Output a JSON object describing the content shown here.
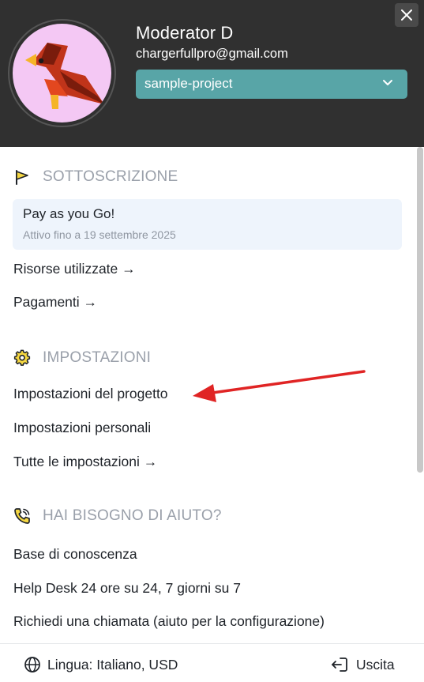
{
  "user": {
    "name": "Moderator D",
    "email": "chargerfullpro@gmail.com",
    "avatar_icon": "cardinal-bird-avatar"
  },
  "project_select": {
    "value": "sample-project"
  },
  "subscription": {
    "title": "SOTTOSCRIZIONE",
    "icon": "flag-icon",
    "plan_name": "Pay as you Go!",
    "plan_valid": "Attivo fino a 19 settembre 2025",
    "links": [
      "Risorse utilizzate →",
      "Pagamenti →"
    ]
  },
  "settings": {
    "title": "IMPOSTAZIONI",
    "icon": "gear-icon",
    "links": [
      "Impostazioni del progetto",
      "Impostazioni personali",
      "Tutte le impostazioni →"
    ]
  },
  "help": {
    "title": "HAI BISOGNO DI AIUTO?",
    "icon": "phone-icon",
    "links": [
      "Base di conoscenza",
      "Help Desk 24 ore su 24, 7 giorni su 7",
      "Richiedi una chiamata (aiuto per la configurazione)"
    ]
  },
  "footer": {
    "language": "Lingua: Italiano, USD",
    "logout": "Uscita"
  },
  "colors": {
    "header_bg": "#303030",
    "project_select_bg": "#58a5a7",
    "plan_box_bg": "#eef4fc",
    "annotation_arrow": "#e02424",
    "flag_yellow": "#f5d742"
  }
}
